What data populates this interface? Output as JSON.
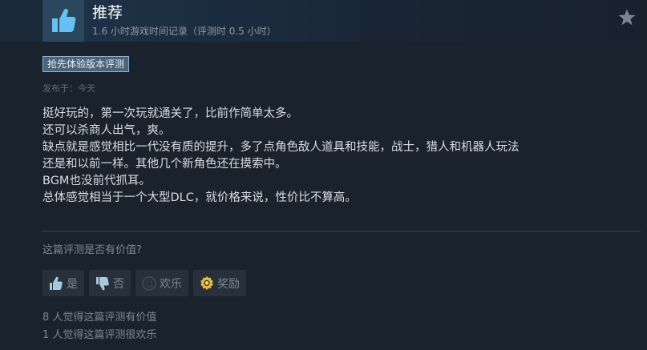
{
  "review": {
    "recommendation": "推荐",
    "hours": "1.6 小时游戏时间记录（评测时 0.5 小时）",
    "early_access_badge": "抢先体验版本评测",
    "posted": "发布于：今天",
    "body_lines": [
      "挺好玩的，第一次玩就通关了，比前作简单太多。",
      "还可以杀商人出气，爽。",
      "缺点就是感觉相比一代没有质的提升，多了点角色敌人道具和技能，战士，猎人和机器人玩法",
      "还是和以前一样。其他几个新角色还在摸索中。",
      "BGM也没前代抓耳。",
      "总体感觉相当于一个大型DLC，就价格来说，性价比不算高。"
    ]
  },
  "feedback": {
    "question": "这篇评测是否有价值?",
    "yes_label": "是",
    "no_label": "否",
    "funny_label": "欢乐",
    "award_label": "奖励",
    "helpful_count": "8 人觉得这篇评测有价值",
    "funny_count": "1 人觉得这篇评测很欢乐"
  },
  "icons": {
    "recommend": "thumbs-up-icon",
    "favorite": "star-icon",
    "yes": "thumbs-up-icon",
    "no": "thumbs-down-icon",
    "funny": "smiley-icon",
    "award": "award-icon"
  },
  "colors": {
    "accent": "#66c0f4",
    "badge_bg": "#4b6479"
  }
}
